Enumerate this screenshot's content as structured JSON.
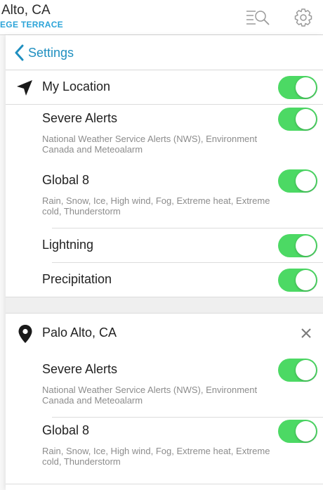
{
  "header": {
    "city": "Alto, CA",
    "subtitle": "EGE TERRACE",
    "search_icon": "search-list-icon",
    "settings_icon": "gear-icon"
  },
  "panel": {
    "back_label": "Settings",
    "my_location": {
      "title": "My Location",
      "enabled": true,
      "severe_alerts": {
        "title": "Severe Alerts",
        "desc": "National Weather Service Alerts (NWS), Environment Canada and Meteoalarm",
        "enabled": true
      },
      "global8": {
        "title": "Global 8",
        "desc": "Rain, Snow, Ice, High wind, Fog, Extreme heat, Extreme cold, Thunderstorm",
        "enabled": true
      },
      "lightning": {
        "title": "Lightning",
        "enabled": true
      },
      "precipitation": {
        "title": "Precipitation",
        "enabled": true
      }
    },
    "palo_alto": {
      "title": "Palo Alto, CA",
      "severe_alerts": {
        "title": "Severe Alerts",
        "desc": "National Weather Service Alerts (NWS), Environment Canada and Meteoalarm",
        "enabled": true
      },
      "global8": {
        "title": "Global 8",
        "desc": "Rain, Snow, Ice, High wind, Fog, Extreme heat, Extreme cold, Thunderstorm",
        "enabled": true
      }
    }
  },
  "colors": {
    "toggle_on": "#4cd964",
    "link": "#1f8fc0",
    "subtitle": "#2aa3d8"
  }
}
